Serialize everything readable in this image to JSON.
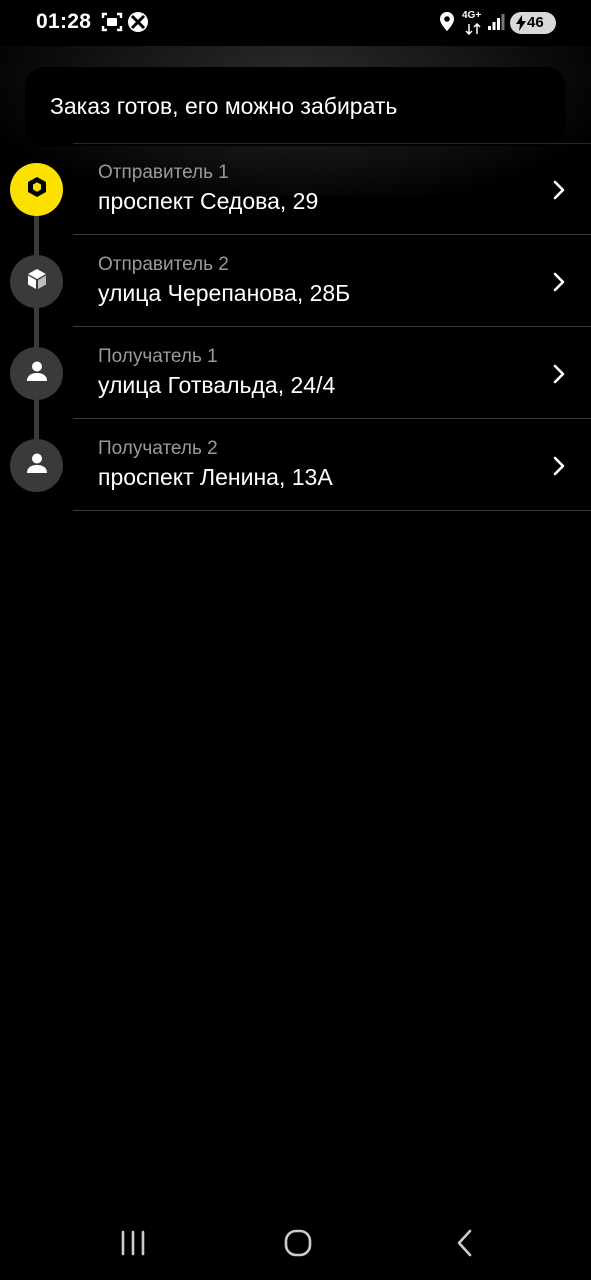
{
  "status_bar": {
    "time": "01:28",
    "network": "4G+",
    "battery_level": "46",
    "icons": [
      "screenshot-icon",
      "xbox-icon",
      "location-icon",
      "signal-icon",
      "battery-icon"
    ]
  },
  "toast": {
    "text": "Заказ готов, его можно забирать"
  },
  "route": {
    "points": [
      {
        "role": "Отправитель 1",
        "address": "проспект Седова, 29",
        "icon": "box-icon",
        "active": true
      },
      {
        "role": "Отправитель 2",
        "address": "улица Черепанова, 28Б",
        "icon": "box-icon",
        "active": false
      },
      {
        "role": "Получатель 1",
        "address": "улица Готвальда, 24/4",
        "icon": "person-icon",
        "active": false
      },
      {
        "role": "Получатель 2",
        "address": "проспект Ленина, 13А",
        "icon": "person-icon",
        "active": false
      }
    ]
  },
  "colors": {
    "accent": "#fce000",
    "background": "#000000",
    "marker_inactive": "#3a3a3a",
    "secondary_text": "#9a9a9a"
  },
  "nav_bar": {
    "buttons": [
      "recent-apps-icon",
      "home-icon",
      "back-icon"
    ]
  }
}
